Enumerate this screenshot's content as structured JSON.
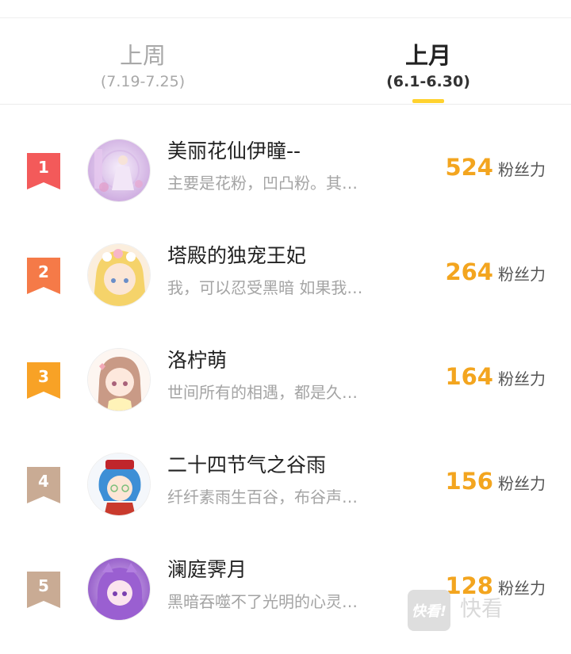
{
  "tabs": [
    {
      "label": "上周",
      "range": "(7.19-7.25)"
    },
    {
      "label": "上月",
      "range": "(6.1-6.30)"
    }
  ],
  "ranking": [
    {
      "rank": "1",
      "name": "美丽花仙伊瞳--",
      "desc": "主要是花粉，凹凸粉。其…",
      "score": "524",
      "unit": "粉丝力"
    },
    {
      "rank": "2",
      "name": "塔殿的独宠王妃",
      "desc": "我，可以忍受黑暗 如果我…",
      "score": "264",
      "unit": "粉丝力"
    },
    {
      "rank": "3",
      "name": "洛柠萌",
      "desc": "世间所有的相遇，都是久…",
      "score": "164",
      "unit": "粉丝力"
    },
    {
      "rank": "4",
      "name": "二十四节气之谷雨",
      "desc": "纤纤素雨生百谷，布谷声…",
      "score": "156",
      "unit": "粉丝力"
    },
    {
      "rank": "5",
      "name": "澜庭霁月",
      "desc": "黑暗吞噬不了光明的心灵…",
      "score": "128",
      "unit": "粉丝力"
    }
  ],
  "colors": {
    "rank_badges": [
      "#f35a5a",
      "#f57a48",
      "#f8a226",
      "#c9ab94",
      "#c9ab94"
    ],
    "score": "#f3a51f",
    "tab_underline": "#ffd22f"
  },
  "watermark": {
    "box_text": "快看!",
    "text": "快看"
  }
}
